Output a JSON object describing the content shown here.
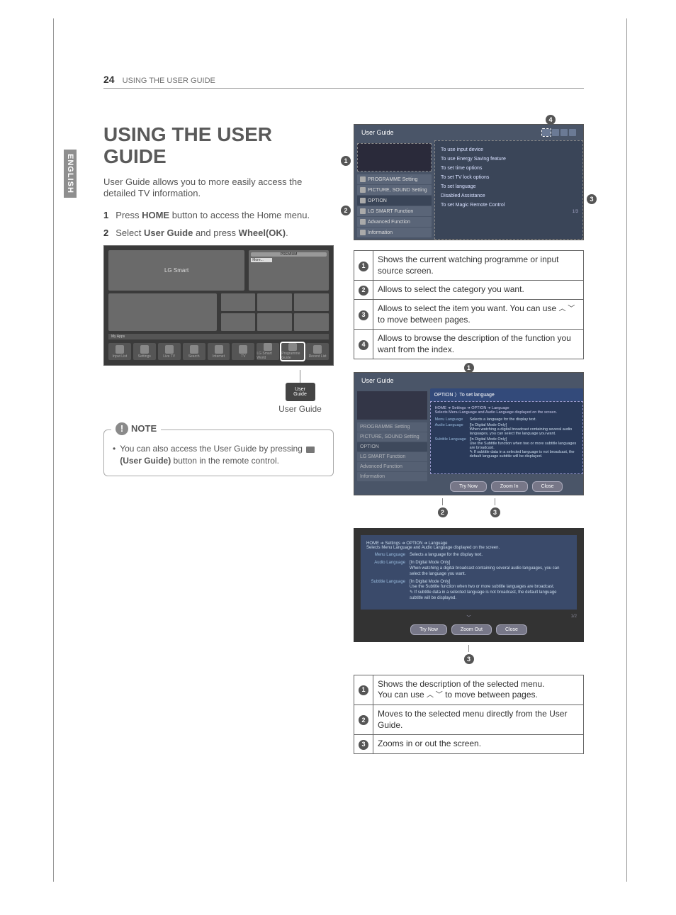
{
  "header": {
    "page_number": "24",
    "section": "USING THE USER GUIDE"
  },
  "language_tab": "ENGLISH",
  "title": "USING THE USER GUIDE",
  "intro": "User Guide allows you to more easily access the detailed TV information.",
  "steps": [
    {
      "num": "1",
      "pre": "Press ",
      "bold": "HOME",
      "post": " button to access the Home menu."
    },
    {
      "num": "2",
      "pre": "Select ",
      "bold": "User Guide",
      "post_pre": " and press ",
      "bold2": "Wheel(OK)",
      "post": "."
    }
  ],
  "home_screen": {
    "brand": "LG Smart",
    "premium_label": "PREMIUM",
    "more_label": "More...",
    "apps_strip_label": "My Apps",
    "dock": [
      "Input List",
      "Settings",
      "Live TV",
      "Search",
      "Internet",
      "TV",
      "LG Smart World",
      "Programme Guide",
      "Recent List"
    ],
    "popup_label": "User Guide",
    "popup_box": "User Guide"
  },
  "note": {
    "label": "NOTE",
    "text_pre": "You can also access the User Guide by pressing ",
    "text_bold": "(User Guide)",
    "text_post": " button in the remote control."
  },
  "ug_screen1": {
    "title": "User Guide",
    "side_items": [
      "PROGRAMME Setting",
      "PICTURE, SOUND Setting",
      "OPTION",
      "LG SMART Function",
      "Advanced Function",
      "Information"
    ],
    "main_items": [
      "To use input device",
      "To use Energy Saving feature",
      "To set time options",
      "To set TV lock options",
      "To set language",
      "Disabled Assistance",
      "To set Magic Remote Control"
    ],
    "page_ind": "1/3"
  },
  "table1": [
    {
      "n": "1",
      "text": "Shows the current watching programme or input source screen."
    },
    {
      "n": "2",
      "text": "Allows to select the category you want."
    },
    {
      "n": "3",
      "text_pre": "Allows to select the item you want.\nYou can use ",
      "arrows": "︿ ﹀",
      "text_post": " to move between pages."
    },
    {
      "n": "4",
      "text": "Allows to browse the description of the function you want from the index."
    }
  ],
  "ug_screen2": {
    "title": "User Guide",
    "breadcrumb": "OPTION 〉To set language",
    "subhead": "HOME ➔ Settings ➔ OPTION ➔ Language\nSelects Menu Language and Audio Language displayed on the screen.",
    "rows": [
      {
        "l": "Menu Language",
        "r": "Selects a language for the display text."
      },
      {
        "l": "Audio Language",
        "r": "[In Digital Mode Only]\nWhen watching a digital broadcast containing several audio languages, you can select the language you want."
      },
      {
        "l": "Subtitle Language",
        "r": "[In Digital Mode Only]\nUse the Subtitle function when two or more subtitle languages are broadcast.\n✎ If subtitle data in a selected language is not broadcast, the default language subtitle will be displayed."
      }
    ],
    "buttons": [
      "Try Now",
      "Zoom In",
      "Close"
    ]
  },
  "zoom_screen": {
    "subhead": "HOME ➔ Settings ➔ OPTION ➔ Language\nSelects Menu Language and Audio Language displayed on the screen.",
    "rows": [
      {
        "l": "Menu Language",
        "r": "Selects a language for the display text."
      },
      {
        "l": "Audio Language",
        "r": "[In Digital Mode Only]\nWhen watching a digital broadcast containing several audio languages, you can select the language you want."
      },
      {
        "l": "Subtitle Language",
        "r": "[In Digital Mode Only]\nUse the Subtitle function when two or more subtitle languages are broadcast.\n✎ If subtitle data in a selected language is not broadcast, the default language subtitle will be displayed."
      }
    ],
    "page_ind": "1/2",
    "buttons": [
      "Try Now",
      "Zoom Out",
      "Close"
    ]
  },
  "table2": [
    {
      "n": "1",
      "text_pre": "Shows the description of the selected menu.\nYou can use ",
      "arrows": "︿ ﹀",
      "text_post": " to move between pages."
    },
    {
      "n": "2",
      "text": "Moves to the selected menu directly from the User Guide."
    },
    {
      "n": "3",
      "text": "Zooms in or out the screen."
    }
  ]
}
